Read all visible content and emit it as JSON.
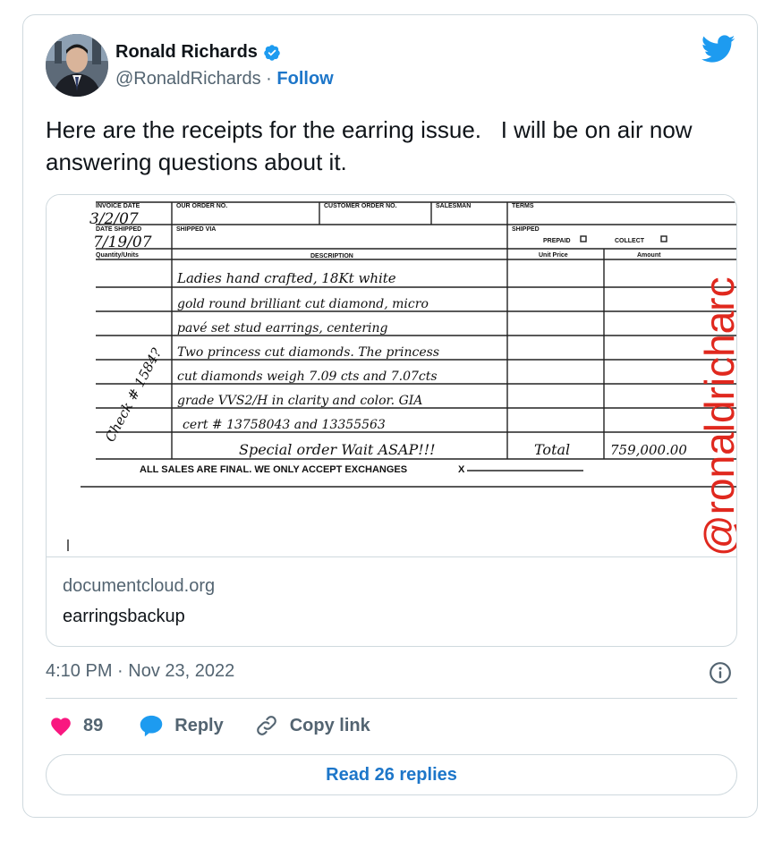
{
  "author": {
    "name": "Ronald Richards",
    "handle": "@RonaldRichards",
    "separator": "·",
    "follow_label": "Follow"
  },
  "tweet": {
    "text": "Here are the receipts for the earring issue.   I will be on air now answering questions about it."
  },
  "link_card": {
    "domain": "documentcloud.org",
    "title": "earringsbackup",
    "document": {
      "headers": {
        "invoice_date": "INVOICE DATE",
        "our_order": "OUR ORDER NO.",
        "customer_order": "CUSTOMER ORDER NO.",
        "salesman": "SALESMAN",
        "terms": "TERMS",
        "date_shipped": "DATE SHIPPED",
        "shipped_via": "SHIPPED VIA",
        "shipped": "SHIPPED",
        "prepaid": "PREPAID",
        "collect": "COLLECT",
        "quantity": "Quantity/Units",
        "description": "DESCRIPTION",
        "unit_price": "Unit Price",
        "amount": "Amount"
      },
      "invoice_date_value": "3/2/07",
      "date_shipped_value": "7/19/07",
      "description_lines": [
        "Ladies hand crafted, 18Kt white",
        "gold round brilliant cut diamond, micro",
        "pavé set stud earrings, centering",
        "Two princess cut diamonds. The princess",
        "cut diamonds weigh 7.09 cts and 7.07cts",
        "grade VVS2/H in clarity and color. GIA",
        "cert # 13758043 and 13355563",
        "Special order Wait ASAP!!!"
      ],
      "margin_note": "Check # 1584?",
      "total_label": "Total",
      "total_value": "759,000.00",
      "footer_text": "ALL SALES ARE FINAL. WE ONLY ACCEPT EXCHANGES",
      "signature_label": "X",
      "watermark": "@ronaldricharc"
    }
  },
  "meta": {
    "timestamp": "4:10 PM · Nov 23, 2022"
  },
  "actions": {
    "like_count": "89",
    "reply_label": "Reply",
    "copy_link_label": "Copy link"
  },
  "read_replies_label": "Read 26 replies",
  "colors": {
    "accent": "#1d76c9",
    "like": "#f91880",
    "muted": "#536471",
    "border": "#cfd9de",
    "watermark": "#e0281e"
  },
  "icons": [
    "verified-badge-icon",
    "twitter-bird-icon",
    "info-icon",
    "heart-icon",
    "reply-bubble-icon",
    "link-icon"
  ]
}
